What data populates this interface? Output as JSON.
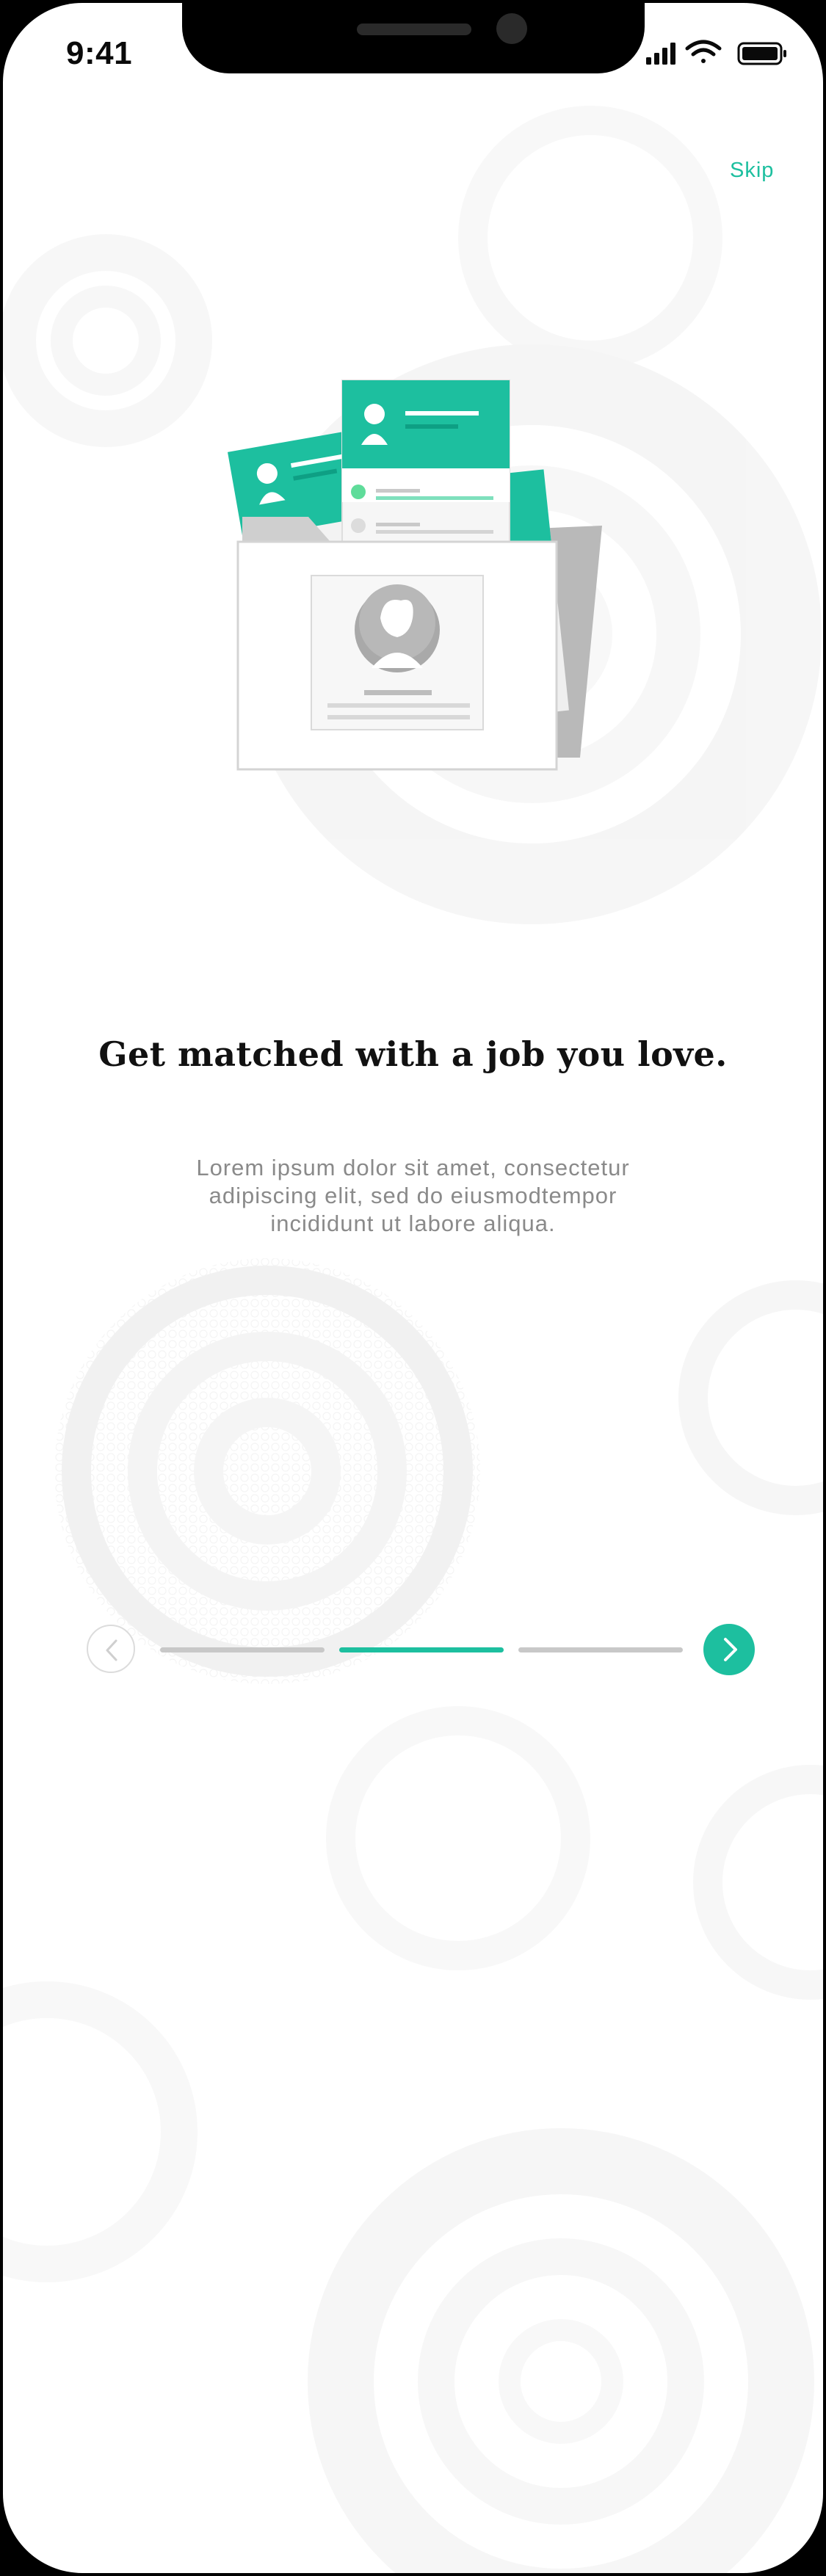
{
  "status_bar": {
    "time": "9:41",
    "icons": [
      "cellular-signal-icon",
      "wifi-icon",
      "battery-icon"
    ]
  },
  "header": {
    "skip_label": "Skip"
  },
  "onboarding": {
    "headline": "Get matched with a job you love.",
    "body_line_1": "Lorem ipsum dolor sit amet, consectetur",
    "body_line_2": "adipiscing elit, sed do eiusmodtempor",
    "body_line_3": "incididunt ut labore aliqua.",
    "illustration_icon": "job-folder-illustration"
  },
  "pager": {
    "prev_icon": "chevron-left-icon",
    "next_icon": "chevron-right-icon",
    "total_steps": 3,
    "current_step": 2
  },
  "colors": {
    "accent": "#1dbf9f",
    "inactive": "#c8c8c8",
    "text_primary": "#111111",
    "text_secondary": "#8a8a8a"
  }
}
